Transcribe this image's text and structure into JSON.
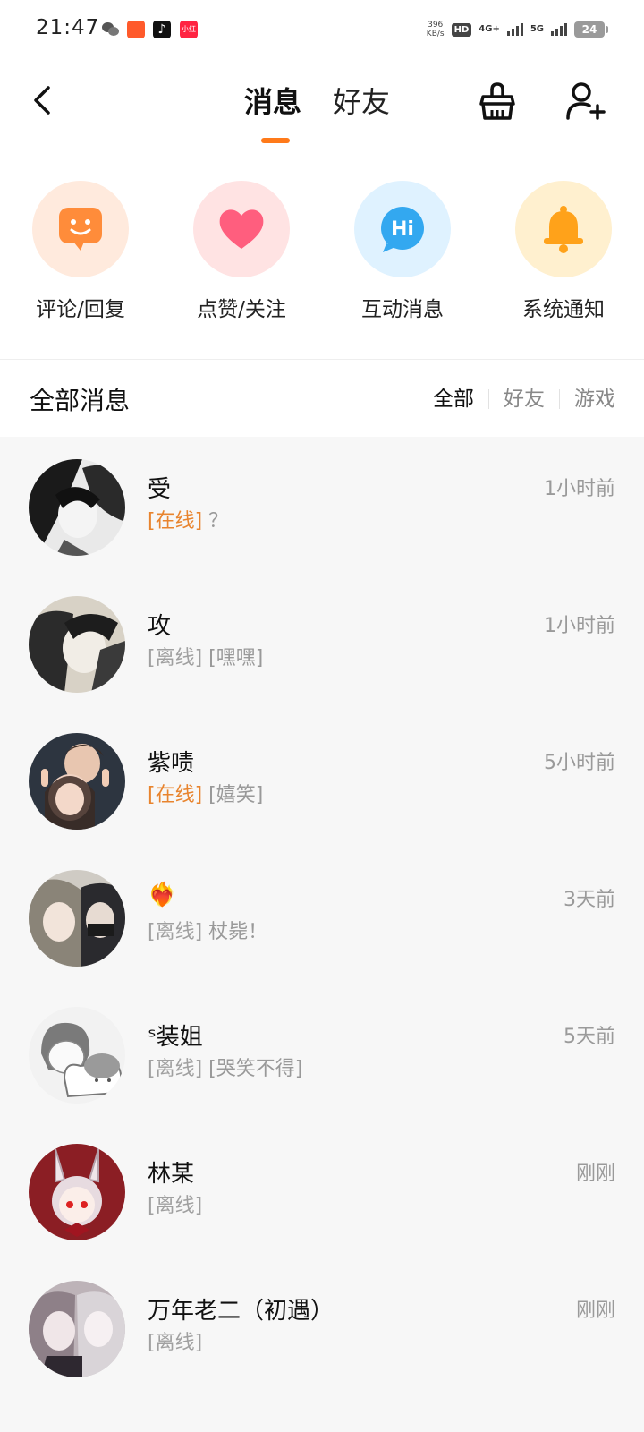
{
  "statusbar": {
    "time": "21:47",
    "speed_value": "396",
    "speed_unit": "KB/s",
    "hd": "HD",
    "net1": "4G+",
    "net2": "5G",
    "battery": "24"
  },
  "header": {
    "tabs": [
      {
        "label": "消息",
        "active": true
      },
      {
        "label": "好友",
        "active": false
      }
    ],
    "accent_color": "#ff7a1a"
  },
  "quick_entries": [
    {
      "label": "评论/回复",
      "icon": "comment-icon",
      "color": "#ff8c3a"
    },
    {
      "label": "点赞/关注",
      "icon": "heart-icon",
      "color": "#ff5e7e"
    },
    {
      "label": "互动消息",
      "icon": "hi-icon",
      "color": "#33a8f0"
    },
    {
      "label": "系统通知",
      "icon": "bell-icon",
      "color": "#ffa21a"
    }
  ],
  "section": {
    "title": "全部消息",
    "filters": [
      {
        "label": "全部",
        "active": true
      },
      {
        "label": "好友",
        "active": false
      },
      {
        "label": "游戏",
        "active": false
      }
    ]
  },
  "conversations": [
    {
      "name": "受",
      "status": "[在线]",
      "online": true,
      "message": "？",
      "time": "1小时前"
    },
    {
      "name": "攻",
      "status": "[离线]",
      "online": false,
      "message": "[嘿嘿]",
      "time": "1小时前"
    },
    {
      "name": "紫啧",
      "status": "[在线]",
      "online": true,
      "message": "[嬉笑]",
      "time": "5小时前"
    },
    {
      "name": "❤‍🔥",
      "status": "[离线]",
      "online": false,
      "message": "杖毙！",
      "time": "3天前"
    },
    {
      "name": "ˢ装姐",
      "status": "[离线]",
      "online": false,
      "message": "[哭笑不得]",
      "time": "5天前"
    },
    {
      "name": "林某",
      "status": "[离线]",
      "online": false,
      "message": "",
      "time": "刚刚"
    },
    {
      "name": "万年老二（初遇）",
      "status": "[离线]",
      "online": false,
      "message": "",
      "time": "刚刚"
    }
  ]
}
